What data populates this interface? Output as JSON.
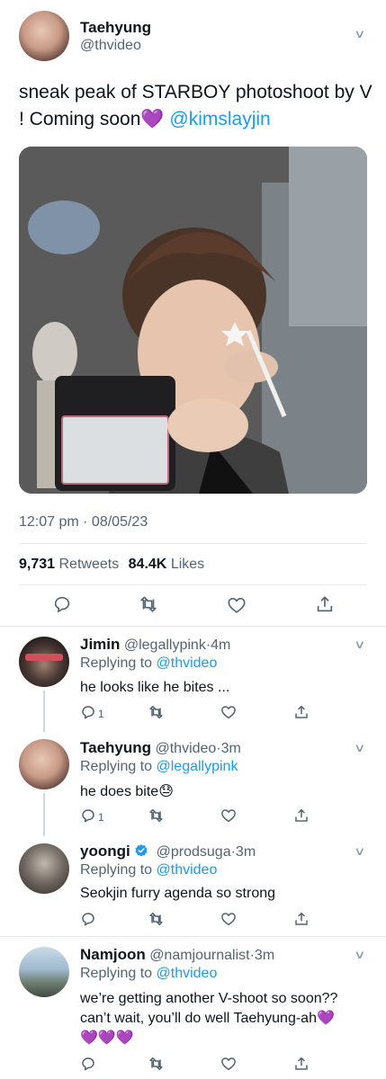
{
  "main_tweet": {
    "author_name": "Taehyung",
    "author_handle": "@thvideo",
    "text": "sneak peak of STARBOY photoshoot by V ! Coming soon",
    "emoji": "💜",
    "mention": "@kimslayjin",
    "timestamp": "12:07 pm · 08/05/23",
    "retweets_count": "9,731",
    "retweets_label": "Retweets",
    "likes_count": "84.4K",
    "likes_label": "Likes",
    "photo_icon": "photo-of-person-with-phone"
  },
  "replies": [
    {
      "name": "Jimin",
      "handle": "@legallypink",
      "dot": "·",
      "time": "4m",
      "replying_label": "Replying to",
      "replying_to": "@thvideo",
      "text": "he looks like he bites ...",
      "reply_count": "1"
    },
    {
      "name": "Taehyung",
      "handle": "@thvideo",
      "dot": "·",
      "time": "3m",
      "replying_label": "Replying to",
      "replying_to": "@legallypink",
      "text": "he does bite",
      "emoji": "😓",
      "reply_count": "1"
    },
    {
      "name": "yoongi",
      "handle": "@prodsuga",
      "dot": "·",
      "time": "3m",
      "replying_label": "Replying to",
      "replying_to": "@thvideo",
      "text": "Seokjin furry agenda so strong",
      "verified": true
    },
    {
      "name": "Namjoon",
      "handle": "@namjournalist",
      "dot": "·",
      "time": "3m",
      "replying_label": "Replying to",
      "replying_to": "@thvideo",
      "text_line1": "we’re getting another V-shoot so soon??",
      "text_line2": "can’t wait, you’ll do well Taehyung-ah",
      "emoji_end": "💜",
      "emoji_row": "💜💜💜"
    }
  ],
  "colors": {
    "link": "#1d9bf0",
    "secondary_text": "#536471",
    "divider": "#e7e9ea",
    "heart_emoji": "#8b3ad6"
  }
}
